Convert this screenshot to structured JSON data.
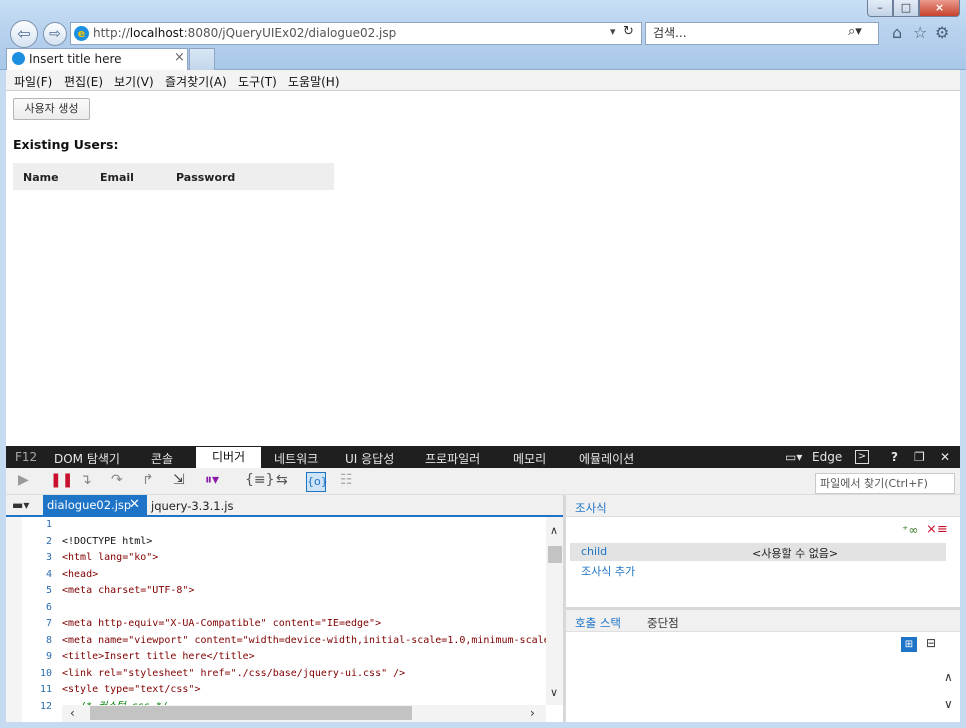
{
  "browser": {
    "window_controls": {
      "minimize": "–",
      "maximize": "□",
      "close": "×"
    },
    "address": {
      "prefix": "http://",
      "host": "localhost",
      "rest": ":8080/jQueryUIEx02/dialogue02.jsp",
      "dropdown": "▾",
      "refresh": "↻"
    },
    "search": {
      "placeholder": "검색...",
      "icon": "⌕▾"
    },
    "top_icons": {
      "home": "⌂",
      "favorites": "☆",
      "tools": "⚙"
    },
    "tab": {
      "title": "Insert title here",
      "close": "×"
    },
    "menu": [
      "파일(F)",
      "편집(E)",
      "보기(V)",
      "즐겨찾기(A)",
      "도구(T)",
      "도움말(H)"
    ]
  },
  "page": {
    "create_button": "사용자 생성",
    "heading": "Existing Users:",
    "columns": [
      "Name",
      "Email",
      "Password"
    ]
  },
  "devtools": {
    "f12": "F12",
    "tabs": [
      "DOM 탐색기",
      "콘솔",
      "디버거",
      "네트워크",
      "UI 응답성",
      "프로파일러",
      "메모리",
      "에뮬레이션"
    ],
    "active_tab": "디버거",
    "mode": "Edge",
    "help": "?",
    "find_placeholder": "파일에서 찾기(Ctrl+F)",
    "file_tabs": [
      "dialogue02.jsp",
      "jquery-3.3.1.js"
    ],
    "code": [
      {
        "n": "1",
        "t": ""
      },
      {
        "n": "2",
        "t": "<!DOCTYPE html>"
      },
      {
        "n": "3",
        "t": "<html lang=\"ko\">"
      },
      {
        "n": "4",
        "t": "<head>"
      },
      {
        "n": "5",
        "t": "<meta charset=\"UTF-8\">"
      },
      {
        "n": "6",
        "t": ""
      },
      {
        "n": "7",
        "t": "<meta http-equiv=\"X-UA-Compatible\" content=\"IE=edge\">"
      },
      {
        "n": "8",
        "t": "<meta name=\"viewport\" content=\"width=device-width,initial-scale=1.0,minimum-scale=1"
      },
      {
        "n": "9",
        "t": "<title>Insert title here</title>"
      },
      {
        "n": "10",
        "t": "<link rel=\"stylesheet\" href=\"./css/base/jquery-ui.css\" />"
      },
      {
        "n": "11",
        "t": "<style type=\"text/css\">"
      },
      {
        "n": "12",
        "t": "   /* 커스텀 css */"
      }
    ],
    "watch": {
      "title": "조사식",
      "row_name": "child",
      "row_value": "<사용할 수 없음>",
      "add": "조사식 추가"
    },
    "bottom_tabs": [
      "호출 스택",
      "중단점"
    ]
  }
}
